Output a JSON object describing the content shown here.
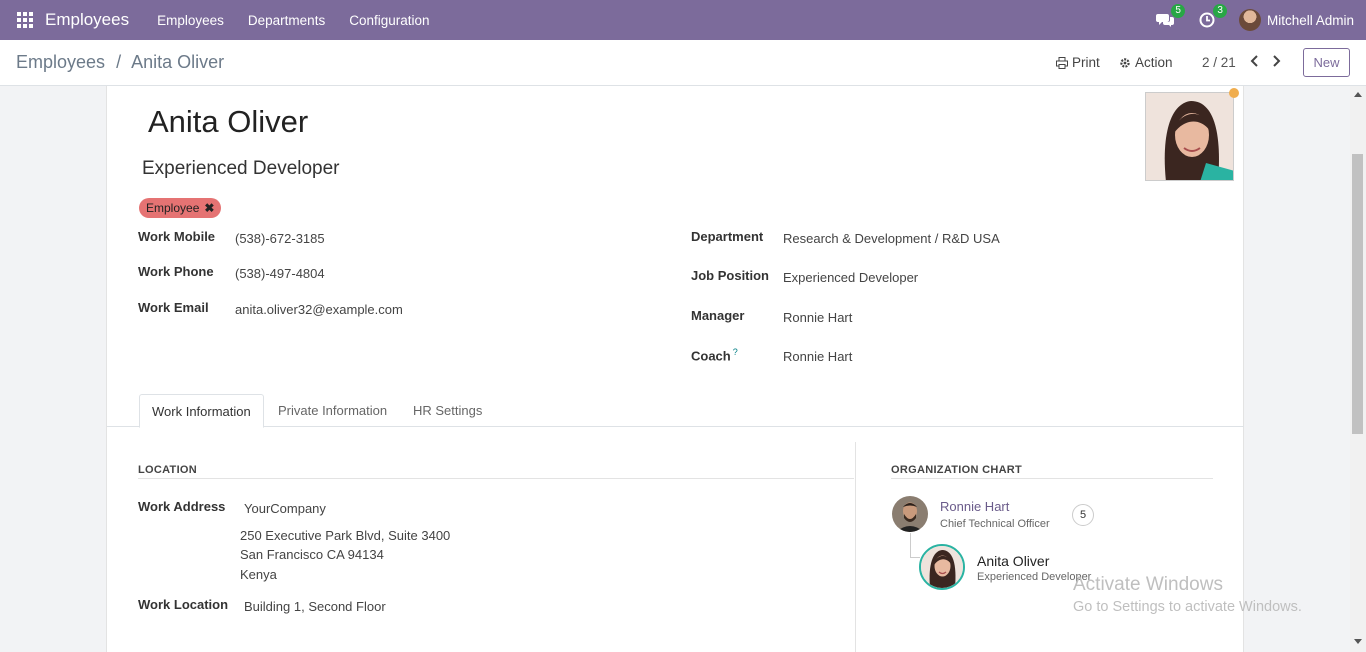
{
  "app": {
    "title": "Employees",
    "menu": [
      "Employees",
      "Departments",
      "Configuration"
    ],
    "messages_count": "5",
    "activities_count": "3",
    "user_name": "Mitchell Admin"
  },
  "controlpanel": {
    "breadcrumb_root": "Employees",
    "breadcrumb_sep": "/",
    "breadcrumb_current": "Anita Oliver",
    "print_label": "Print",
    "action_label": "Action",
    "pager": "2 / 21",
    "new_label": "New"
  },
  "employee": {
    "name": "Anita Oliver",
    "job_title": "Experienced Developer",
    "tag": "Employee",
    "fields_left": [
      {
        "label": "Work Mobile",
        "value": "(538)-672-3185"
      },
      {
        "label": "Work Phone",
        "value": "(538)-497-4804"
      },
      {
        "label": "Work Email",
        "value": "anita.oliver32@example.com"
      }
    ],
    "fields_right": [
      {
        "label": "Department",
        "value": "Research & Development / R&D USA"
      },
      {
        "label": "Job Position",
        "value": "Experienced Developer"
      },
      {
        "label": "Manager",
        "value": "Ronnie Hart"
      },
      {
        "label": "Coach",
        "value": "Ronnie Hart",
        "help": "?"
      }
    ]
  },
  "tabs": [
    "Work Information",
    "Private Information",
    "HR Settings"
  ],
  "location": {
    "title": "LOCATION",
    "work_address_label": "Work Address",
    "company": "YourCompany",
    "address_lines": [
      "250 Executive Park Blvd, Suite 3400",
      "San Francisco CA 94134",
      "Kenya"
    ],
    "work_location_label": "Work Location",
    "work_location": "Building 1, Second Floor"
  },
  "org_chart": {
    "title": "ORGANIZATION CHART",
    "manager_name": "Ronnie Hart",
    "manager_job": "Chief Technical Officer",
    "manager_count": "5",
    "self_name": "Anita Oliver",
    "self_job": "Experienced Developer"
  },
  "watermark": {
    "line1": "Activate Windows",
    "line2": "Go to Settings to activate Windows."
  },
  "colors": {
    "brand": "#7c6b9b",
    "tag": "#e57373",
    "badge": "#28a745",
    "status": "#f0ad4e"
  }
}
